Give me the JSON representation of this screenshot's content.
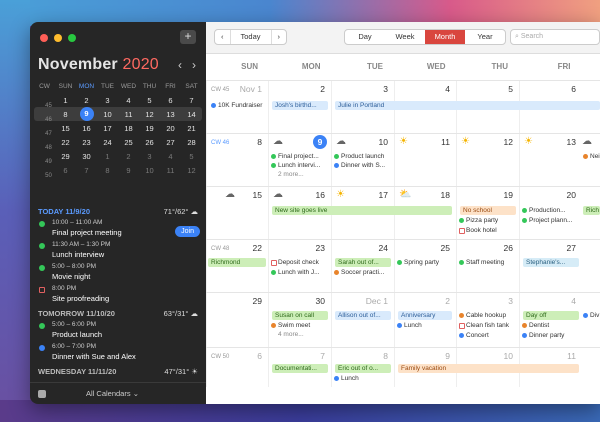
{
  "sidebar": {
    "month_name": "November",
    "year": "2020",
    "add_label": "+",
    "prev_label": "‹",
    "next_label": "›",
    "headers": [
      "CW",
      "SUN",
      "MON",
      "TUE",
      "WED",
      "THU",
      "FRI",
      "SAT"
    ],
    "weeks": [
      {
        "cw": "45",
        "days": [
          "1",
          "2",
          "3",
          "4",
          "5",
          "6",
          "7"
        ]
      },
      {
        "cw": "46",
        "days": [
          "8",
          "9",
          "10",
          "11",
          "12",
          "13",
          "14"
        ]
      },
      {
        "cw": "47",
        "days": [
          "15",
          "16",
          "17",
          "18",
          "19",
          "20",
          "21"
        ]
      },
      {
        "cw": "48",
        "days": [
          "22",
          "23",
          "24",
          "25",
          "26",
          "27",
          "28"
        ]
      },
      {
        "cw": "49",
        "days": [
          "29",
          "30",
          "1",
          "2",
          "3",
          "4",
          "5"
        ]
      },
      {
        "cw": "50",
        "days": [
          "6",
          "7",
          "8",
          "9",
          "10",
          "11",
          "12"
        ]
      }
    ],
    "agenda": {
      "today_label": "TODAY 11/9/20",
      "today_weather": "71°/62° ☁",
      "join_label": "Join",
      "today_events": [
        {
          "time": "10:00 – 11:00 AM",
          "title": "Final project meeting",
          "color": "#34c759"
        },
        {
          "time": "11:30 AM – 1:30 PM",
          "title": "Lunch interview",
          "color": "#34c759"
        },
        {
          "time": "5:00 – 8:00 PM",
          "title": "Movie night",
          "color": "#34c759"
        },
        {
          "time": "8:00 PM",
          "title": "Site proofreading",
          "color": "#e06060",
          "square": true
        }
      ],
      "tomorrow_label": "TOMORROW 11/10/20",
      "tomorrow_weather": "63°/31° ☁",
      "tomorrow_events": [
        {
          "time": "5:00 – 6:00 PM",
          "title": "Product launch",
          "color": "#34c759"
        },
        {
          "time": "6:00 – 7:00 PM",
          "title": "Dinner with Sue and Alex",
          "color": "#3b82f6"
        }
      ],
      "wednesday_label": "WEDNESDAY 11/11/20",
      "wednesday_weather": "47°/31° ☀"
    },
    "footer_label": "All Calendars ⌄"
  },
  "toolbar": {
    "prev": "‹",
    "today": "Today",
    "next": "›",
    "views": [
      "Day",
      "Week",
      "Month",
      "Year"
    ],
    "active_view": "Month",
    "search_placeholder": "Search"
  },
  "dow": [
    "SUN",
    "MON",
    "TUE",
    "WED",
    "THU",
    "FRI"
  ],
  "month": {
    "weeks": [
      {
        "cw": "CW 45",
        "days": [
          "Nov 1",
          "2",
          "3",
          "4",
          "5",
          "6"
        ]
      },
      {
        "cw": "CW 46",
        "days": [
          "8",
          "9",
          "10",
          "11",
          "12",
          "13"
        ]
      },
      {
        "cw": "",
        "days": [
          "15",
          "16",
          "17",
          "18",
          "19",
          "20"
        ]
      },
      {
        "cw": "CW 48",
        "days": [
          "22",
          "23",
          "24",
          "25",
          "26",
          "27"
        ]
      },
      {
        "cw": "",
        "days": [
          "29",
          "30",
          "Dec 1",
          "2",
          "3",
          "4"
        ]
      },
      {
        "cw": "CW 50",
        "days": [
          "6",
          "7",
          "8",
          "9",
          "10",
          "11"
        ]
      }
    ],
    "events": {
      "fundraiser": "10K Fundraiser",
      "josh": "Josh's birthd...",
      "julie": "Julie in Portland",
      "final_proj": "Final project...",
      "lunch_intv": "Lunch intervi...",
      "more1": "2 more...",
      "prod_launch": "Product launch",
      "dinner_sue": "Dinner with S...",
      "nei": "Nei",
      "site_live": "New site goes live",
      "no_school": "No school",
      "pizza": "Pizza party",
      "book_hotel": "Book hotel",
      "production": "Production...",
      "proj_plan": "Project plann...",
      "rich": "Rich",
      "richmond": "Richmond",
      "deposit": "Deposit check",
      "lunch_j": "Lunch with J...",
      "sarah": "Sarah out of...",
      "soccer": "Soccer practi...",
      "spring": "Spring party",
      "staff": "Staff meeting",
      "stephanie": "Stephanie's...",
      "susan": "Susan on call",
      "swim": "Swim meet",
      "more2": "4 more...",
      "allison": "Allison out of...",
      "anniv": "Anniversary",
      "lunch2": "Lunch",
      "cable": "Cable hookup",
      "clean": "Clean fish tank",
      "concert": "Concert",
      "dayoff": "Day off",
      "dentist": "Dentist",
      "dinnerp": "Dinner party",
      "div": "Div",
      "docs": "Documentati...",
      "eric": "Eric out of o...",
      "lunch3": "Lunch",
      "vacation": "Family vacation"
    }
  }
}
